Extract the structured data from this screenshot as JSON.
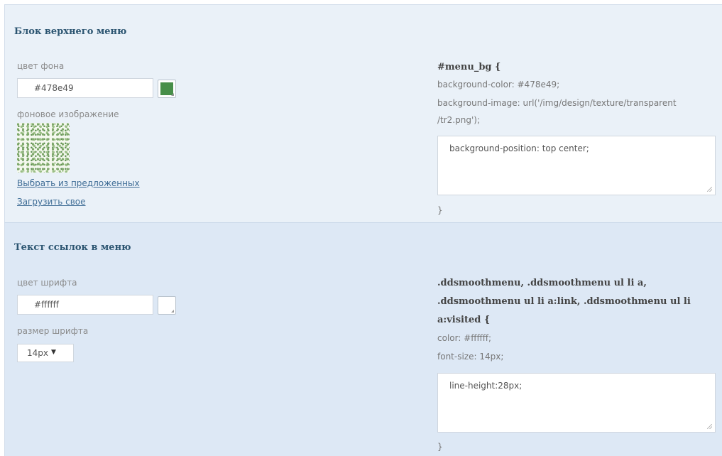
{
  "block_menu": {
    "title": "Блок верхнего меню",
    "bg_color_label": "цвет фона",
    "bg_color_value": "#478e49",
    "bg_color_swatch": "#478e49",
    "bg_image_label": "фоновое изображение",
    "choose_link": "Выбрать из предложенных",
    "upload_link": "Загрузить свое",
    "css": {
      "selector": "#menu_bg {",
      "line1": "background-color: #478e49;",
      "line2": "background-image: url('/img/design/texture/transparent",
      "line3": "/tr2.png');",
      "textarea": "background-position: top center;",
      "close": "}"
    }
  },
  "menu_links": {
    "title": "Текст ссылок в меню",
    "font_color_label": "цвет шрифта",
    "font_color_value": "#ffffff",
    "font_color_swatch": "#ffffff",
    "font_size_label": "размер шрифта",
    "font_size_value": "14px",
    "css": {
      "selector_line1": ".ddsmoothmenu, .ddsmoothmenu ul li a,",
      "selector_line2": ".ddsmoothmenu ul li a:link, .ddsmoothmenu ul li",
      "selector_line3": "a:visited {",
      "line1": "color: #ffffff;",
      "line2": "font-size: 14px;",
      "textarea": "line-height:28px;",
      "close": "}"
    }
  }
}
